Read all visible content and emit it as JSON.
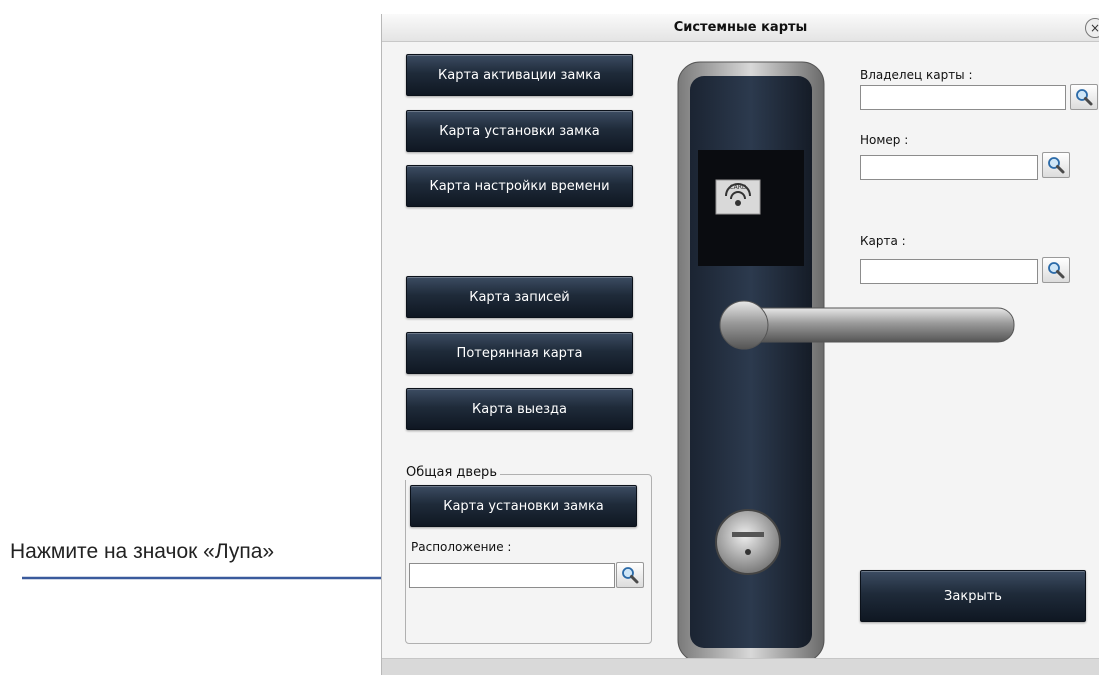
{
  "annotation": {
    "text": "Нажмите на значок «Лупа»"
  },
  "window": {
    "title": "Системные карты",
    "close_glyph": "×"
  },
  "buttons": {
    "activation": "Карта активации замка",
    "install": "Карта установки замка",
    "time_setup": "Карта настройки времени",
    "records": "Карта записей",
    "lost": "Потерянная карта",
    "checkout": "Карта выезда",
    "close": "Закрыть"
  },
  "common_door": {
    "legend": "Общая дверь",
    "install_button": "Карта установки замка",
    "location_label": "Расположение :",
    "location_value": ""
  },
  "right_panel": {
    "owner_label": "Владелец карты :",
    "owner_value": "",
    "number_label": "Номер :",
    "number_value": "",
    "card_label": "Карта :",
    "card_value": ""
  },
  "icons": {
    "search": "magnifier-icon",
    "arrow_color": "#3a5a9c",
    "button_color": "#1f2b3a"
  }
}
